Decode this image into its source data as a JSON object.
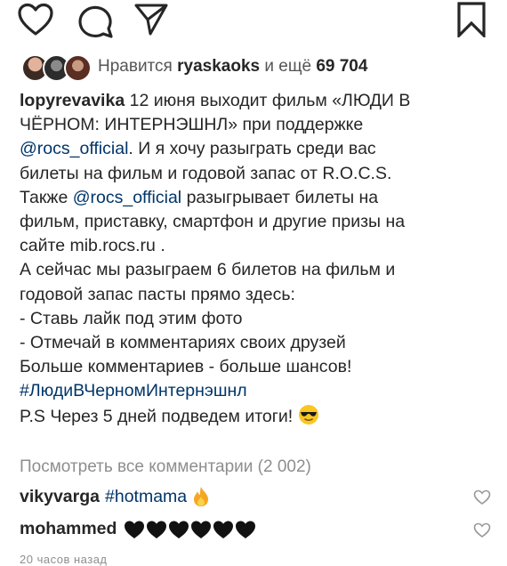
{
  "post": {
    "likes": {
      "prefix": "Нравится",
      "user": "ryaskaoks",
      "middle": "и ещё",
      "count": "69 704"
    },
    "caption": {
      "user": "lopyrevavika",
      "line1": "12 июня выходит фильм «ЛЮДИ В",
      "line2": "ЧЁРНОМ: ИНТЕРНЭШНЛ» при поддержке",
      "mention1": "@rocs_official",
      "line3_rest": ". И я хочу разыграть среди вас",
      "line4": "билеты на фильм и годовой запас от R.O.C.S.",
      "line5_start": "Также",
      "mention2": "@rocs_official",
      "line5_rest": "разыгрывает билеты на",
      "line6": "фильм, приставку, смартфон и другие призы на",
      "line7": "сайте mib.rocs.ru .",
      "line8": "А сейчас мы разыграем 6 билетов на фильм и",
      "line9": "годовой запас пасты прямо здесь:",
      "line10": "- Ставь лайк под этим фото",
      "line11": "- Отмечай в комментариях своих друзей",
      "line12": "Больше комментариев - больше шансов!",
      "hashtag": "#ЛюдиВЧерномИнтернэшнл",
      "line14": "P.S Через 5 дней подведем итоги!"
    },
    "view_all": "Посмотреть все комментарии (2 002)",
    "comments": [
      {
        "user": "vikyvarga",
        "text": "#hotmama"
      },
      {
        "user": "mohammed",
        "text": ""
      }
    ],
    "timestamp": "20 часов назад"
  },
  "icons": {
    "like": "heart-icon",
    "comment": "comment-icon",
    "share": "paper-plane-icon",
    "save": "bookmark-icon"
  },
  "colors": {
    "text": "#262626",
    "link": "#003569",
    "muted": "#8e8e8e",
    "fire": "#f5a623"
  }
}
